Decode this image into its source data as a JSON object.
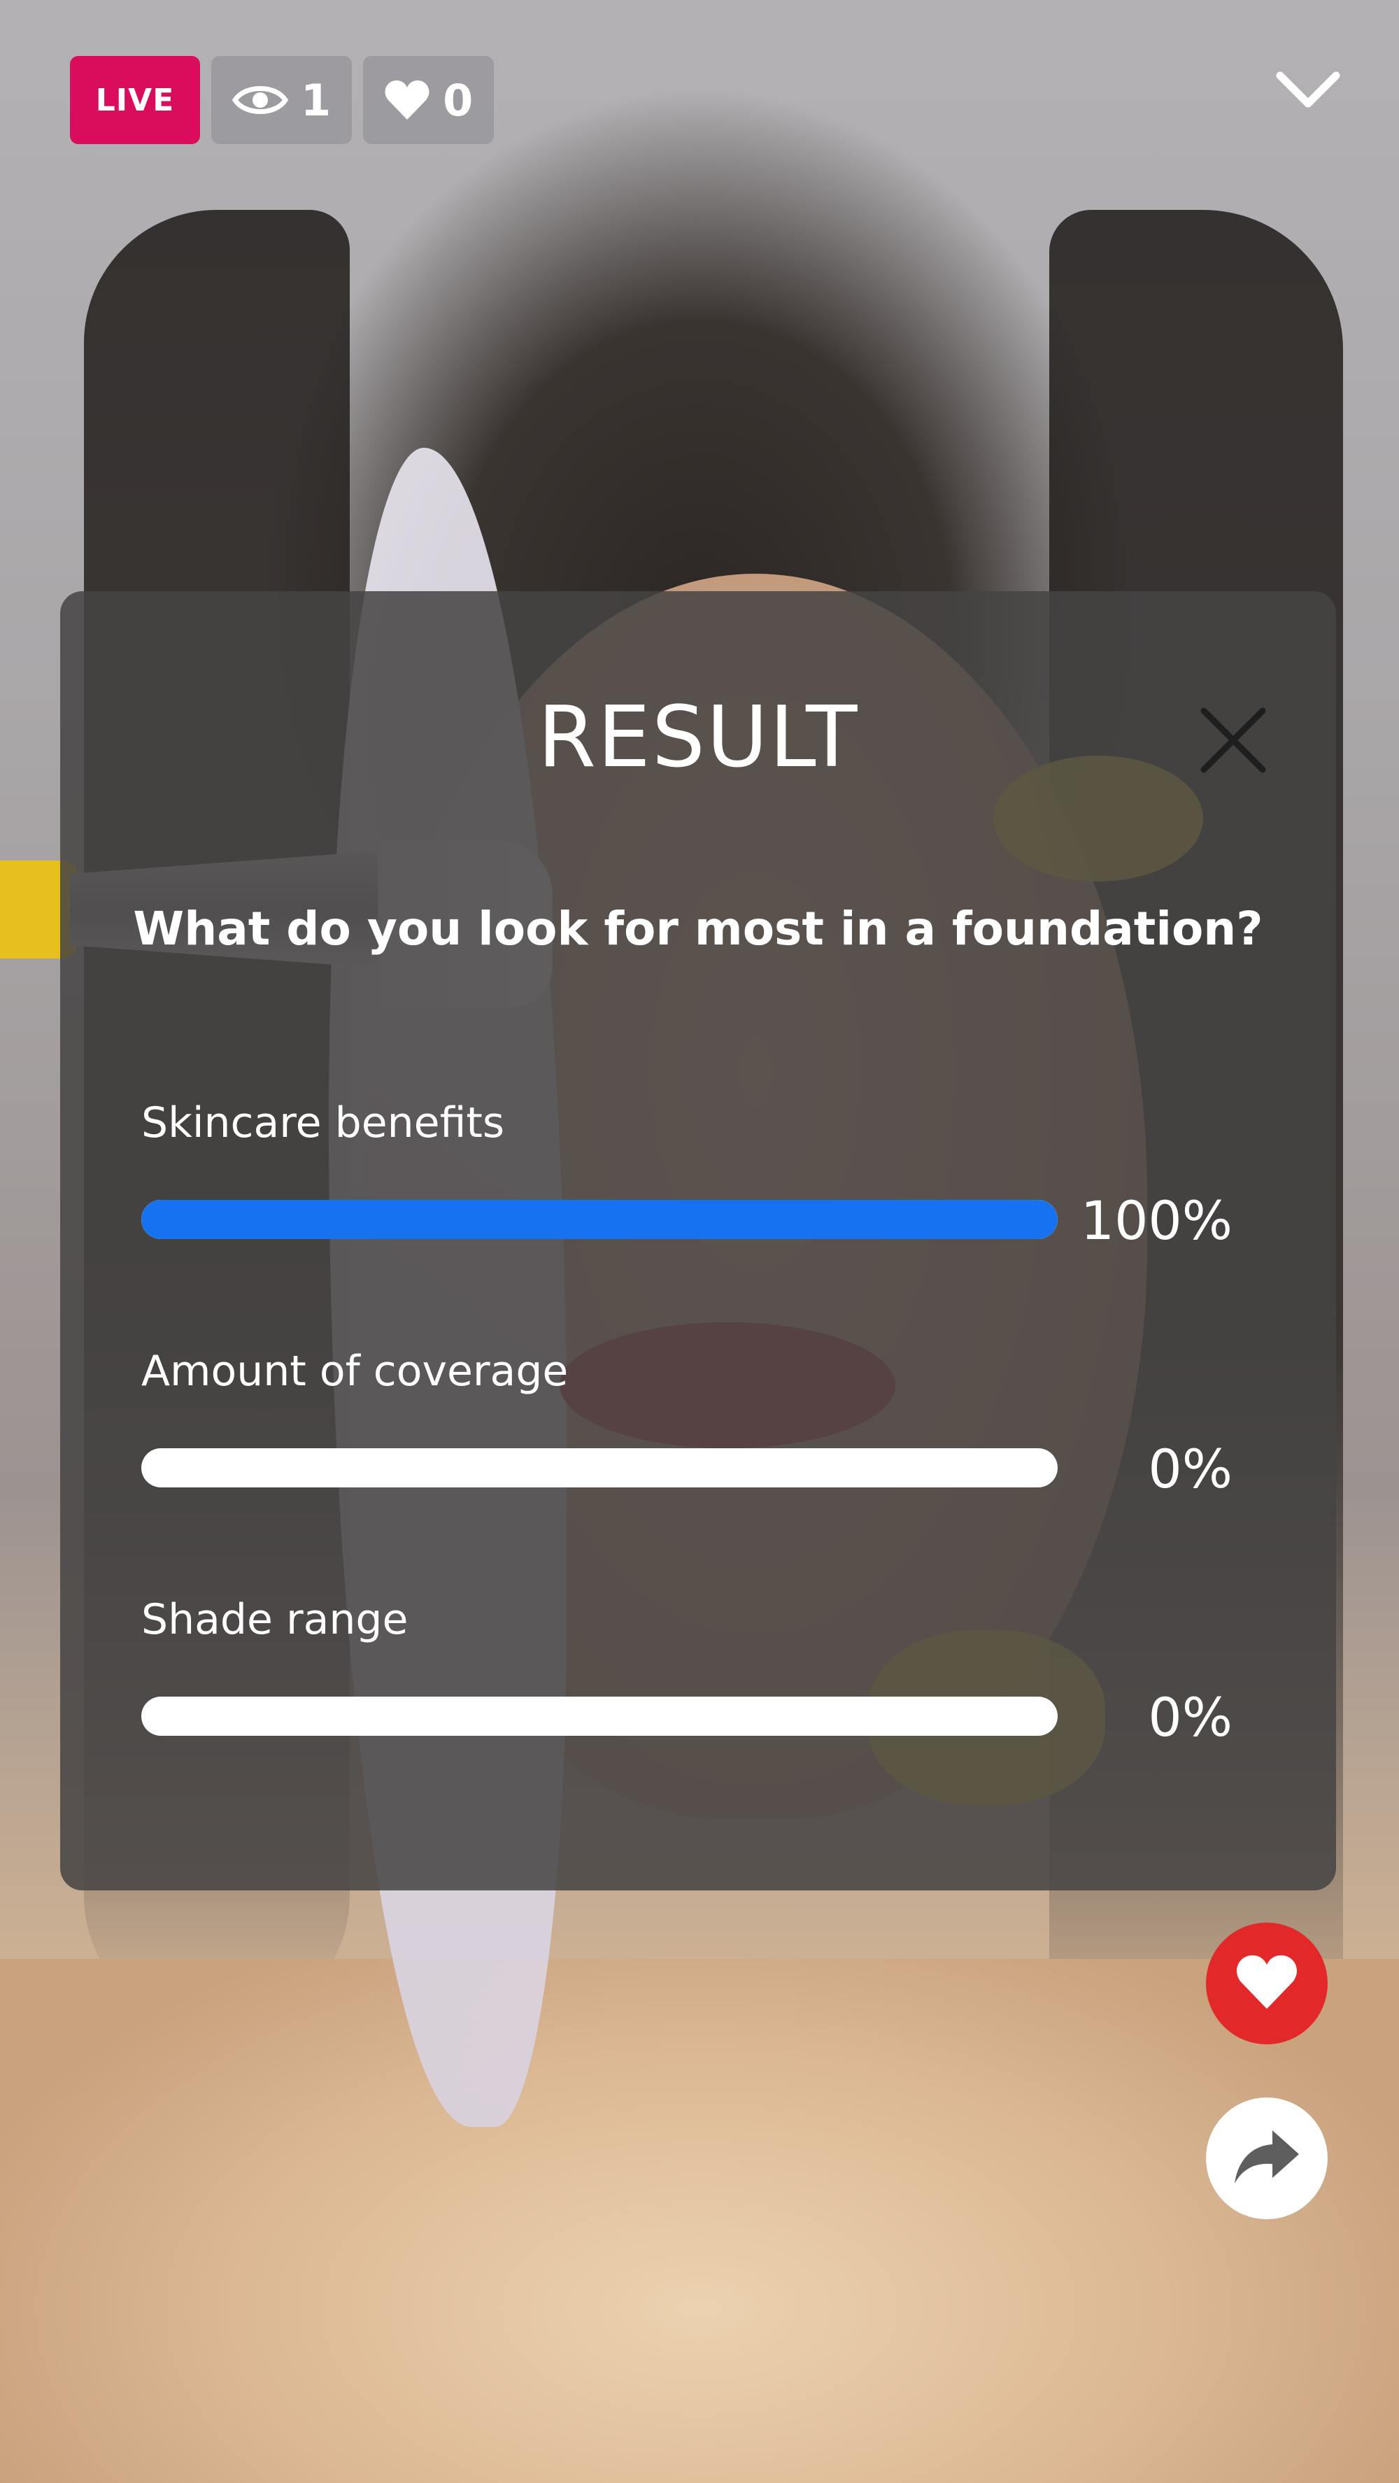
{
  "stream": {
    "live_label": "LIVE",
    "viewer_count": "1",
    "like_count": "0"
  },
  "icons": {
    "viewers": "eye-icon",
    "likes": "heart-icon",
    "collapse": "chevron-down-icon",
    "close": "close-icon",
    "like_button": "heart-icon",
    "share_button": "share-arrow-icon"
  },
  "result": {
    "title": "RESULT",
    "question": "What do you look for most in a foundation?",
    "options": [
      {
        "label": "Skincare benefits",
        "percent": "100%",
        "fraction": 1.0
      },
      {
        "label": "Amount of coverage",
        "percent": "0%",
        "fraction": 0.0
      },
      {
        "label": "Shade range",
        "percent": "0%",
        "fraction": 0.0
      }
    ]
  },
  "colors": {
    "live_badge": "#d90d5c",
    "progress_fill": "#1672f0",
    "progress_track": "#ffffff",
    "like_button": "#e22828",
    "share_button": "#ffffff",
    "panel_background": "#464444"
  }
}
